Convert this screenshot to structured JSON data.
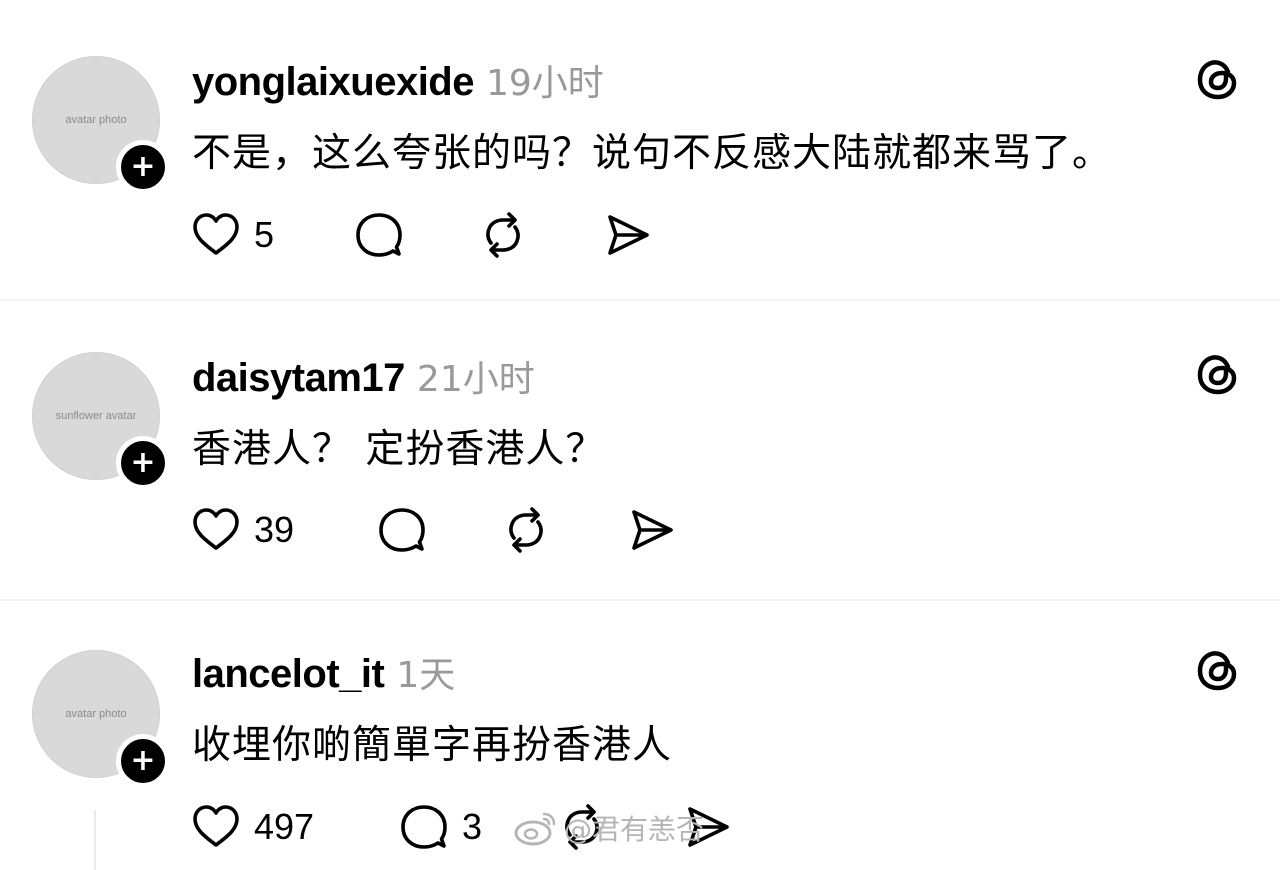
{
  "posts": [
    {
      "username": "yonglaixuexide",
      "time": "19小时",
      "text": "不是，这么夸张的吗？说句不反感大陆就都来骂了。",
      "likes": "5",
      "replies": "",
      "avatar_label": "avatar photo"
    },
    {
      "username": "daisytam17",
      "time": "21小时",
      "text": "香港人？  定扮香港人？",
      "likes": "39",
      "replies": "",
      "avatar_label": "sunflower avatar"
    },
    {
      "username": "lancelot_it",
      "time": "1天",
      "text": "收埋你啲簡單字再扮香港人",
      "likes": "497",
      "replies": "3",
      "avatar_label": "avatar photo"
    }
  ],
  "follow_symbol": "+",
  "watermark": "@君有恙否",
  "icons": {
    "like": "heart-icon",
    "reply": "comment-icon",
    "repost": "repost-icon",
    "share": "share-icon",
    "brand": "threads-logo-icon"
  }
}
